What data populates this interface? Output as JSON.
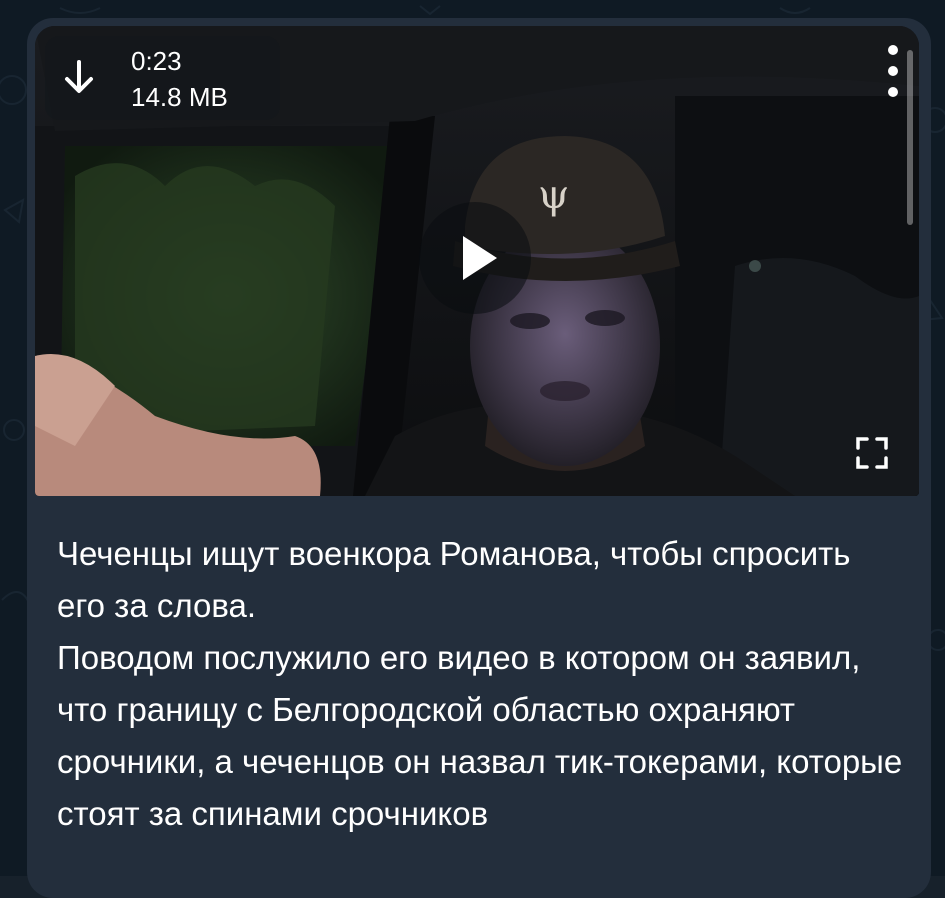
{
  "video": {
    "duration": "0:23",
    "file_size": "14.8 MB",
    "play_state": "paused",
    "cap_logo_text": "ψ"
  },
  "icons": {
    "download": "download-arrow-icon",
    "menu": "more-vertical-icon",
    "play": "play-icon",
    "fullscreen": "fullscreen-icon"
  },
  "message": {
    "paragraph1": "Чеченцы ищут военкора Романова, чтобы спросить его за слова.",
    "paragraph2": "Поводом послужило его видео в котором он заявил, что границу с Белгородской областью охраняют срочники, а чеченцов он назвал тик-токерами, которые стоят за спинами срочников"
  },
  "colors": {
    "bubble": "#232e3c",
    "chat_background": "#0f1a24",
    "text": "#ffffff"
  }
}
